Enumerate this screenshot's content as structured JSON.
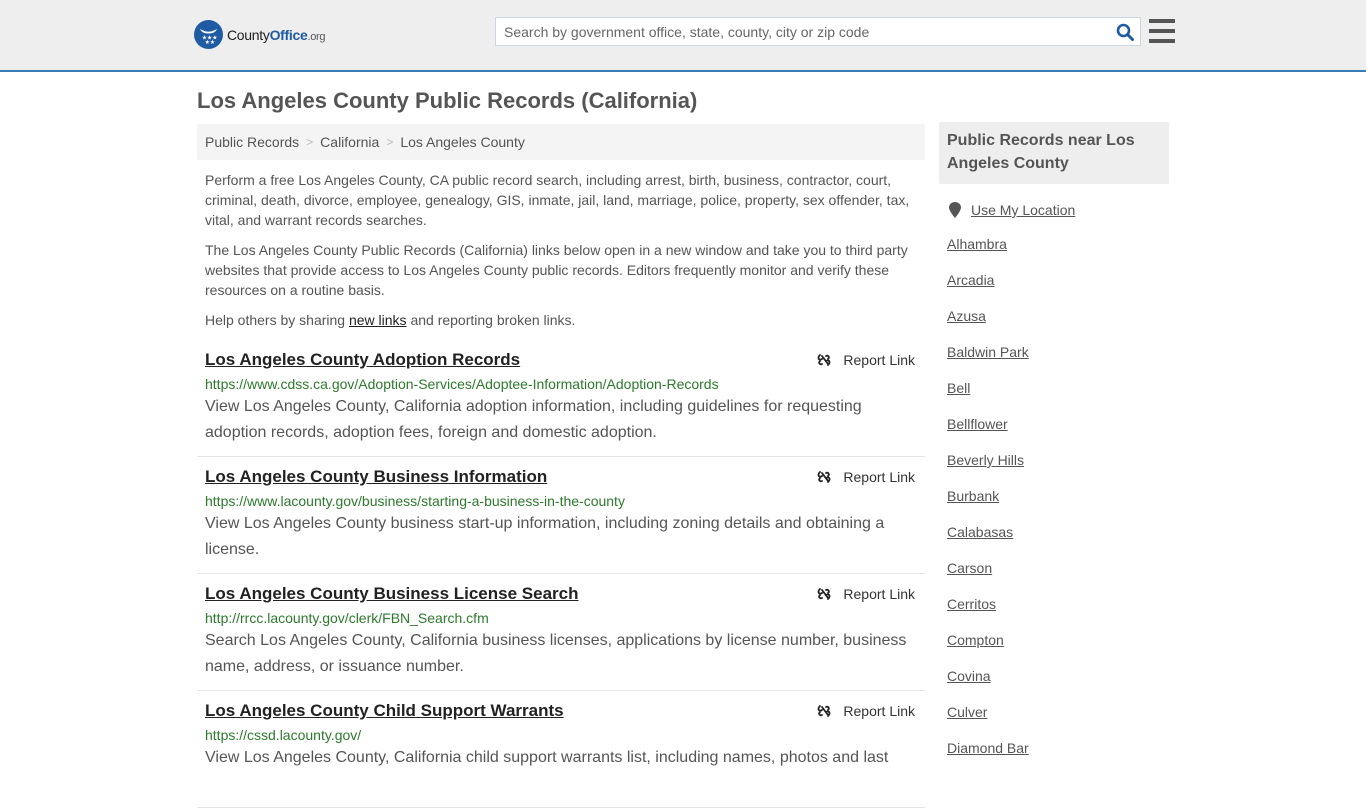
{
  "header": {
    "logo": {
      "brand_prefix": "County",
      "brand_main": "Office",
      "brand_suffix": ".org"
    },
    "search": {
      "placeholder": "Search by government office, state, county, city or zip code",
      "value": ""
    },
    "icons": {
      "search": "search-icon",
      "menu": "hamburger-menu-icon"
    },
    "colors": {
      "brand": "#1f5ba3",
      "border": "#3a7db4"
    }
  },
  "page": {
    "title": "Los Angeles County Public Records (California)",
    "breadcrumb": [
      "Public Records",
      "California",
      "Los Angeles County"
    ],
    "intro": {
      "p1": "Perform a free Los Angeles County, CA public record search, including arrest, birth, business, contractor, court, criminal, death, divorce, employee, genealogy, GIS, inmate, jail, land, marriage, police, property, sex offender, tax, vital, and warrant records searches.",
      "p2": "The Los Angeles County Public Records (California) links below open in a new window and take you to third party websites that provide access to Los Angeles County public records. Editors frequently monitor and verify these resources on a routine basis.",
      "p3_before": "Help others by sharing ",
      "p3_link": "new links",
      "p3_after": " and reporting broken links."
    }
  },
  "records": [
    {
      "title": "Los Angeles County Adoption Records",
      "url": "https://www.cdss.ca.gov/Adoption-Services/Adoptee-Information/Adoption-Records",
      "description": "View Los Angeles County, California adoption information, including guidelines for requesting adoption records, adoption fees, foreign and domestic adoption.",
      "report_label": "Report Link"
    },
    {
      "title": "Los Angeles County Business Information",
      "url": "https://www.lacounty.gov/business/starting-a-business-in-the-county",
      "description": "View Los Angeles County business start-up information, including zoning details and obtaining a license.",
      "report_label": "Report Link"
    },
    {
      "title": "Los Angeles County Business License Search",
      "url": "http://rrcc.lacounty.gov/clerk/FBN_Search.cfm",
      "description": "Search Los Angeles County, California business licenses, applications by license number, business name, address, or issuance number.",
      "report_label": "Report Link"
    },
    {
      "title": "Los Angeles County Child Support Warrants",
      "url": "https://cssd.lacounty.gov/",
      "description": "View Los Angeles County, California child support warrants list, including names, photos and last",
      "report_label": "Report Link"
    }
  ],
  "sidebar": {
    "heading": "Public Records near Los Angeles County",
    "use_location": "Use My Location",
    "cities": [
      "Alhambra",
      "Arcadia",
      "Azusa",
      "Baldwin Park",
      "Bell",
      "Bellflower",
      "Beverly Hills",
      "Burbank",
      "Calabasas",
      "Carson",
      "Cerritos",
      "Compton",
      "Covina",
      "Culver",
      "Diamond Bar"
    ]
  }
}
